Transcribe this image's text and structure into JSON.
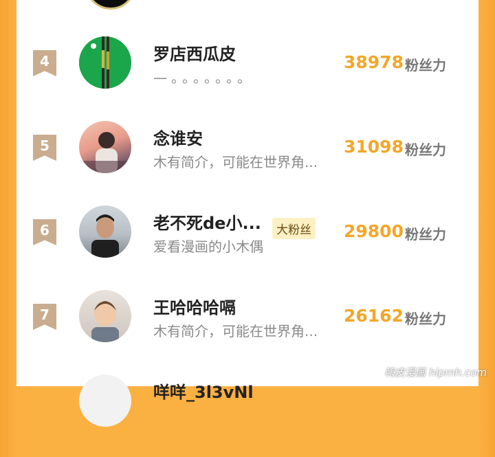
{
  "rows": [
    {
      "rank": "4",
      "name": "罗店西瓜皮",
      "desc": "—。。。。。。。",
      "score": "38978",
      "unit": "粉丝力",
      "badge": ""
    },
    {
      "rank": "5",
      "name": "念谁安",
      "desc": "木有简介，可能在世界角...",
      "score": "31098",
      "unit": "粉丝力",
      "badge": ""
    },
    {
      "rank": "6",
      "name": "老不死de小...",
      "desc": "爱看漫画的小木偶",
      "score": "29800",
      "unit": "粉丝力",
      "badge": "大粉丝"
    },
    {
      "rank": "7",
      "name": "王哈哈哈嗝",
      "desc": "木有简介，可能在世界角...",
      "score": "26162",
      "unit": "粉丝力",
      "badge": ""
    },
    {
      "rank": "",
      "name": "咩咩_3l3vNl",
      "desc": "",
      "score": "",
      "unit": "",
      "badge": ""
    }
  ],
  "watermark": "嗨皮漫画 hipmh.com",
  "colors": {
    "accent": "#f4a628",
    "frame": "#fbb042",
    "rank_badge": "#c9ad8e"
  },
  "icons": {
    "avatar_4": "snooker-table-avatar",
    "avatar_5": "anime-boy-avatar",
    "avatar_6": "man-photo-avatar",
    "avatar_7": "baby-photo-avatar"
  }
}
